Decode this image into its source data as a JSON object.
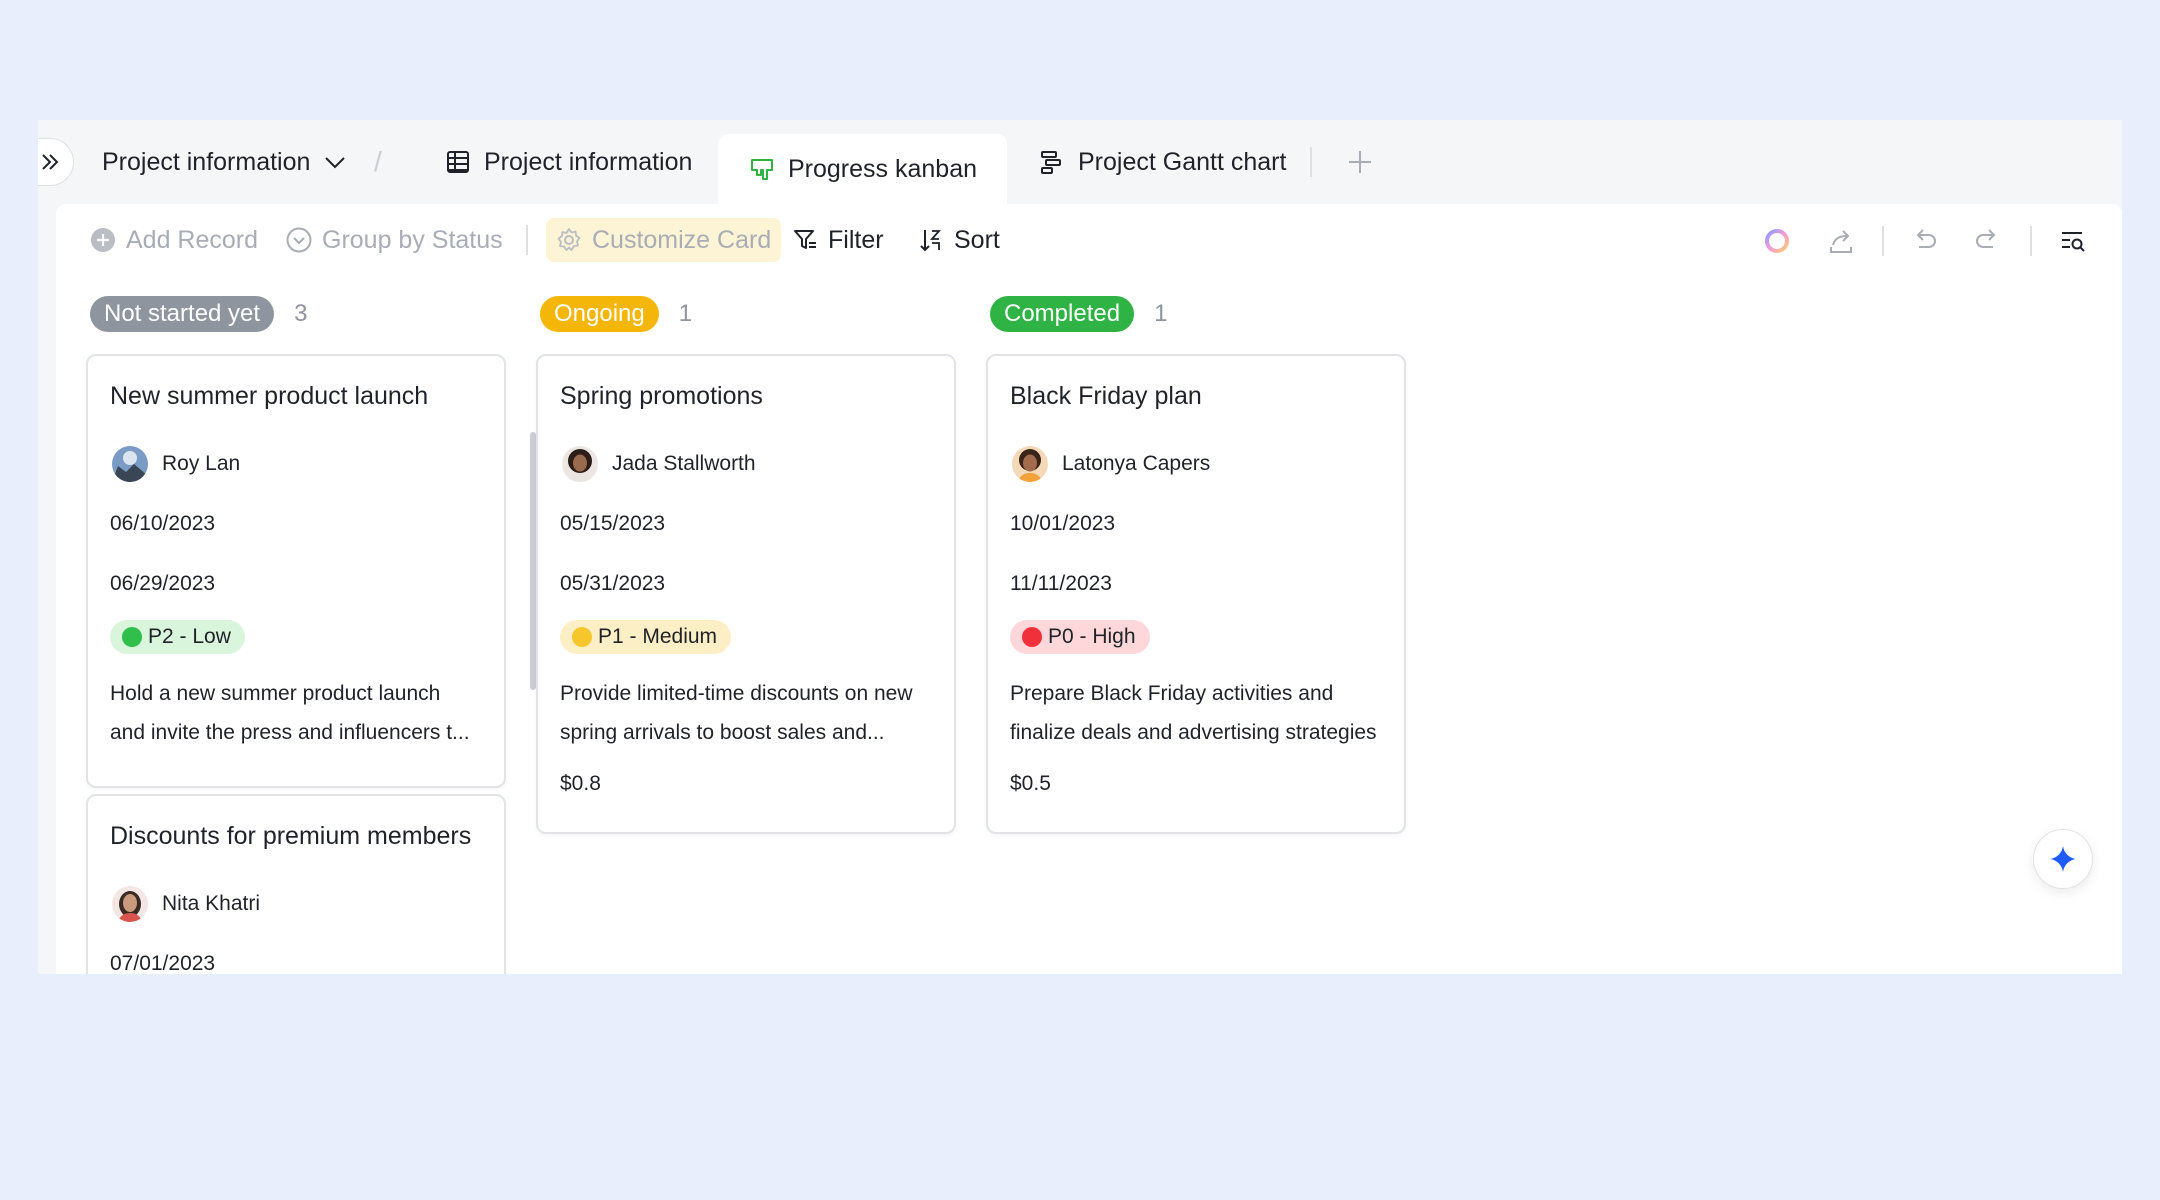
{
  "tabs": {
    "breadcrumb": "Project information",
    "items": [
      {
        "label": "Project information",
        "icon": "grid-table-icon"
      },
      {
        "label": "Progress kanban",
        "icon": "kanban-icon",
        "active": true
      },
      {
        "label": "Project Gantt chart",
        "icon": "gantt-icon"
      }
    ]
  },
  "toolbar": {
    "add_record": "Add Record",
    "group_by": "Group by Status",
    "customize_card": "Customize Card",
    "filter": "Filter",
    "sort": "Sort"
  },
  "columns": [
    {
      "status": "Not started yet",
      "count": "3",
      "color": "#8f959e"
    },
    {
      "status": "Ongoing",
      "count": "1",
      "color": "#f5b60a"
    },
    {
      "status": "Completed",
      "count": "1",
      "color": "#2fb344"
    }
  ],
  "cards": [
    {
      "title": "New summer product launch",
      "person": "Roy Lan",
      "start": "06/10/2023",
      "end": "06/29/2023",
      "priority": "P2 - Low",
      "priority_color": "#2fbf4a",
      "priority_bg": "#d9f5dc",
      "desc_line1": "Hold a new summer product launch",
      "desc_line2": "and invite the press and influencers t...",
      "price": ""
    },
    {
      "title": "Spring promotions",
      "person": "Jada Stallworth",
      "start": "05/15/2023",
      "end": "05/31/2023",
      "priority": "P1 - Medium",
      "priority_color": "#f7c52c",
      "priority_bg": "#fcefc5",
      "desc_line1": "Provide limited-time discounts on new",
      "desc_line2": "spring arrivals to boost sales and...",
      "price": "$0.8"
    },
    {
      "title": "Black Friday plan",
      "person": "Latonya Capers",
      "start": "10/01/2023",
      "end": "11/11/2023",
      "priority": "P0 - High",
      "priority_color": "#f0303b",
      "priority_bg": "#fdd7d9",
      "desc_line1": "Prepare Black Friday activities and",
      "desc_line2": "finalize deals and advertising strategies",
      "price": "$0.5"
    },
    {
      "title": "Discounts for premium members",
      "person": "Nita Khatri",
      "start": "07/01/2023"
    }
  ]
}
